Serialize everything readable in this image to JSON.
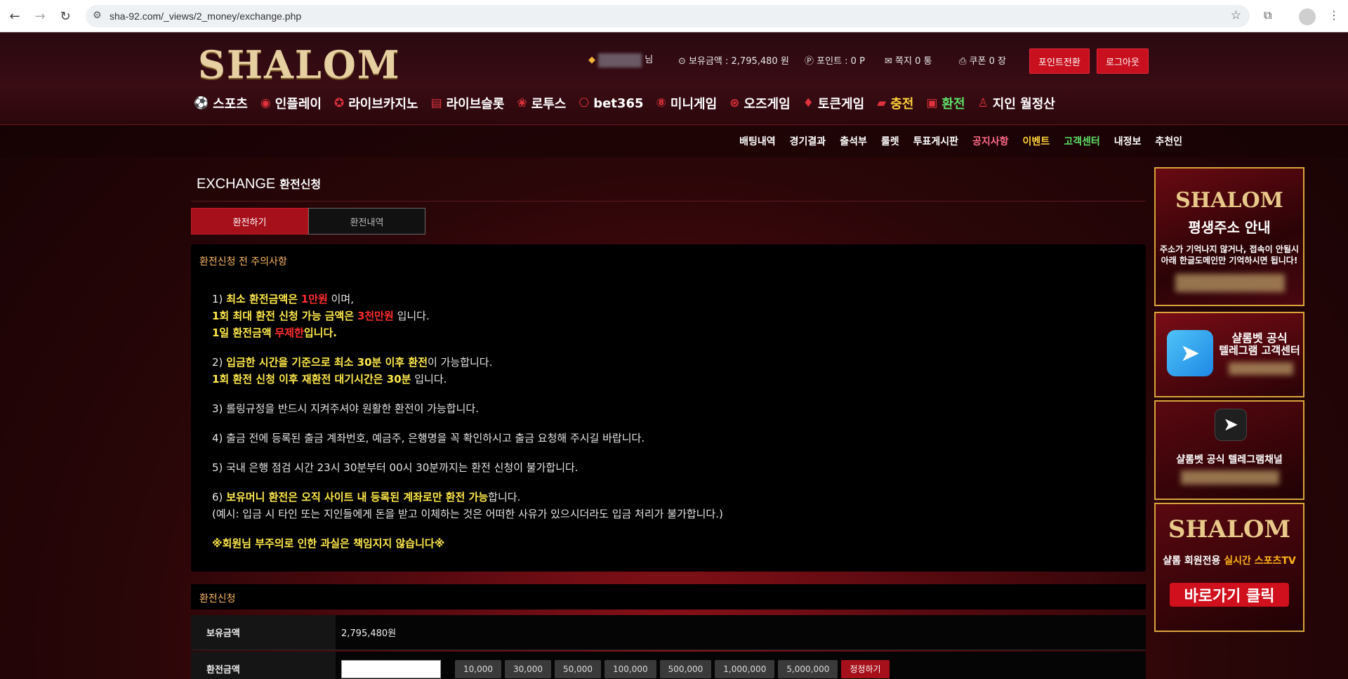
{
  "browser": {
    "url": "sha-92.com/_views/2_money/exchange.php",
    "back_icon": "arrow-left-icon",
    "forward_icon": "arrow-right-icon",
    "reload_icon": "reload-icon"
  },
  "header": {
    "logo": "SHALOM",
    "user_suffix": "님",
    "balance_label": "보유금액 : 2,795,480 원",
    "points_label": "포인트 : 0 P",
    "messages_label": "쪽지 0 통",
    "coupons_label": "쿠폰 0 장",
    "point_convert_btn": "포인트전환",
    "logout_btn": "로그아웃"
  },
  "main_nav": [
    {
      "label": "스포츠",
      "icon": "soccer-ball-icon"
    },
    {
      "label": "인플레이",
      "icon": "live-icon"
    },
    {
      "label": "라이브카지노",
      "icon": "casino-chip-icon"
    },
    {
      "label": "라이브슬롯",
      "icon": "slot-icon"
    },
    {
      "label": "로투스",
      "icon": "lotus-icon"
    },
    {
      "label": "bet365",
      "icon": "gamepad-icon"
    },
    {
      "label": "미니게임",
      "icon": "ball-icon"
    },
    {
      "label": "오즈게임",
      "icon": "oz-icon"
    },
    {
      "label": "토큰게임",
      "icon": "token-icon"
    },
    {
      "label": "충전",
      "icon": "deposit-icon"
    },
    {
      "label": "환전",
      "icon": "exchange-icon"
    },
    {
      "label": "지인 월정산",
      "icon": "person-icon"
    }
  ],
  "sub_nav": [
    "배팅내역",
    "경기결과",
    "출석부",
    "룰렛",
    "투표게시판",
    "공지사항",
    "이벤트",
    "고객센터",
    "내정보",
    "추천인"
  ],
  "page": {
    "title_en": "EXCHANGE",
    "title_ko": "환전신청",
    "tab_active": "환전하기",
    "tab_inactive": "환전내역"
  },
  "notice": {
    "heading": "환전신청 전 주의사항",
    "l1a_num": "1)",
    "l1a_y": "최소 환전금액은",
    "l1a_r": "1만원",
    "l1a_n": "이며,",
    "l1b_y": "1회 최대 환전 신청 가능 금액은",
    "l1b_r": "3천만원",
    "l1b_n": "입니다.",
    "l1c_y": "1일 환전금액",
    "l1c_r": "무제한",
    "l1c_y2": "입니다.",
    "l2a_num": "2)",
    "l2a_y": "입금한 시간을 기준으로 최소 30분 이후 환전",
    "l2a_n": "이 가능합니다.",
    "l2b_y": "1회 환전 신청 이후 재환전 대기시간은 30분",
    "l2b_n": "입니다.",
    "l3": "3) 롤링규정을 반드시 지켜주셔야 원활한 환전이 가능합니다.",
    "l4": "4) 출금 전에 등록된 출금 계좌번호, 예금주, 은행명을 꼭 확인하시고 출금 요청해 주시길 바랍니다.",
    "l5": "5) 국내 은행 점검 시간 23시 30분부터 00시 30분까지는 환전 신청이 불가합니다.",
    "l6a_num": "6)",
    "l6a_y": "보유머니 환전은 오직 사이트 내 등록된 계좌로만 환전 가능",
    "l6a_n": "합니다.",
    "l6b": "(예시: 입금 시 타인 또는 지인들에게 돈을 받고 이체하는 것은 어떠한 사유가 있으시더라도 입금 처리가 불가합니다.)",
    "warning": "※회원님 부주의로 인한 과실은 책임지지 않습니다※"
  },
  "form": {
    "heading": "환전신청",
    "balance_label": "보유금액",
    "balance_value": "2,795,480원",
    "amount_label": "환전금액",
    "amount_buttons": [
      "10,000",
      "30,000",
      "50,000",
      "100,000",
      "500,000",
      "1,000,000",
      "5,000,000"
    ],
    "reset_btn": "정정하기"
  },
  "banners": {
    "b1_logo": "SHALOM",
    "b1_title": "평생주소 안내",
    "b1_line1": "주소가 기억나지 않거나, 접속이 안될시",
    "b1_line2": "아래 한글도메인만 기억하시면 됩니다!",
    "b2_line1": "샬롬벳 공식",
    "b2_line2": "텔레그램 고객센터",
    "b3_text": "샬롬벳 공식 텔레그램채널",
    "b4_logo": "SHALOM",
    "b4_text1": "샬롬 회원전용",
    "b4_text2": "실시간 스포츠TV",
    "b4_btn": "바로가기 클릭"
  }
}
